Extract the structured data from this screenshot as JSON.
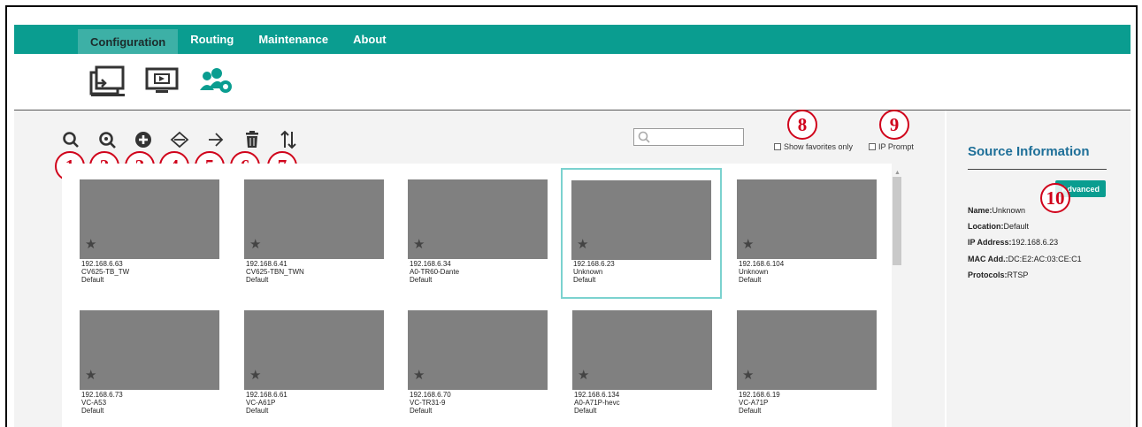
{
  "nav": {
    "tabs": [
      {
        "label": "Configuration",
        "active": true
      },
      {
        "label": "Routing",
        "active": false
      },
      {
        "label": "Maintenance",
        "active": false
      },
      {
        "label": "About",
        "active": false
      }
    ]
  },
  "subnav_icons": [
    "source-transfer-icon",
    "display-monitor-icon",
    "users-settings-icon"
  ],
  "toolbar": {
    "icons": [
      "search-icon",
      "auto-search-icon",
      "add-icon",
      "export-icon",
      "import-icon",
      "delete-icon",
      "sort-icon"
    ]
  },
  "callouts": [
    "1",
    "2",
    "3",
    "4",
    "5",
    "6",
    "7",
    "8",
    "9",
    "10"
  ],
  "search": {
    "value": "",
    "placeholder": ""
  },
  "filters": {
    "favorites_label": "Show favorites only",
    "ip_prompt_label": "IP Prompt"
  },
  "devices": [
    {
      "ip": "192.168.6.63",
      "name": "CV625-TB_TW",
      "location": "Default",
      "selected": false
    },
    {
      "ip": "192.168.6.41",
      "name": "CV625-TBN_TWN",
      "location": "Default",
      "selected": false
    },
    {
      "ip": "192.168.6.34",
      "name": "A0-TR60-Dante",
      "location": "Default",
      "selected": false
    },
    {
      "ip": "192.168.6.23",
      "name": "Unknown",
      "location": "Default",
      "selected": true
    },
    {
      "ip": "192.168.6.104",
      "name": "Unknown",
      "location": "Default",
      "selected": false
    },
    {
      "ip": "192.168.6.73",
      "name": "VC-A53",
      "location": "Default",
      "selected": false
    },
    {
      "ip": "192.168.6.61",
      "name": "VC-A61P",
      "location": "Default",
      "selected": false
    },
    {
      "ip": "192.168.6.70",
      "name": "VC-TR31-9",
      "location": "Default",
      "selected": false
    },
    {
      "ip": "192.168.6.134",
      "name": "A0-A71P-hevc",
      "location": "Default",
      "selected": false
    },
    {
      "ip": "192.168.6.19",
      "name": "VC-A71P",
      "location": "Default",
      "selected": false
    }
  ],
  "source_info": {
    "title": "Source Information",
    "advanced_label": "Advanced",
    "fields": [
      {
        "label": "Name:",
        "value": "Unknown"
      },
      {
        "label": "Location:",
        "value": "Default"
      },
      {
        "label": "IP Address:",
        "value": "192.168.6.23"
      },
      {
        "label": "MAC Add.:",
        "value": "DC:E2:AC:03:CE:C1"
      },
      {
        "label": "Protocols:",
        "value": "RTSP"
      }
    ]
  },
  "colors": {
    "accent": "#0a9d90",
    "title_blue": "#1e6f98",
    "callout_red": "#d0021b",
    "selected_outline": "#7bd2cf"
  }
}
